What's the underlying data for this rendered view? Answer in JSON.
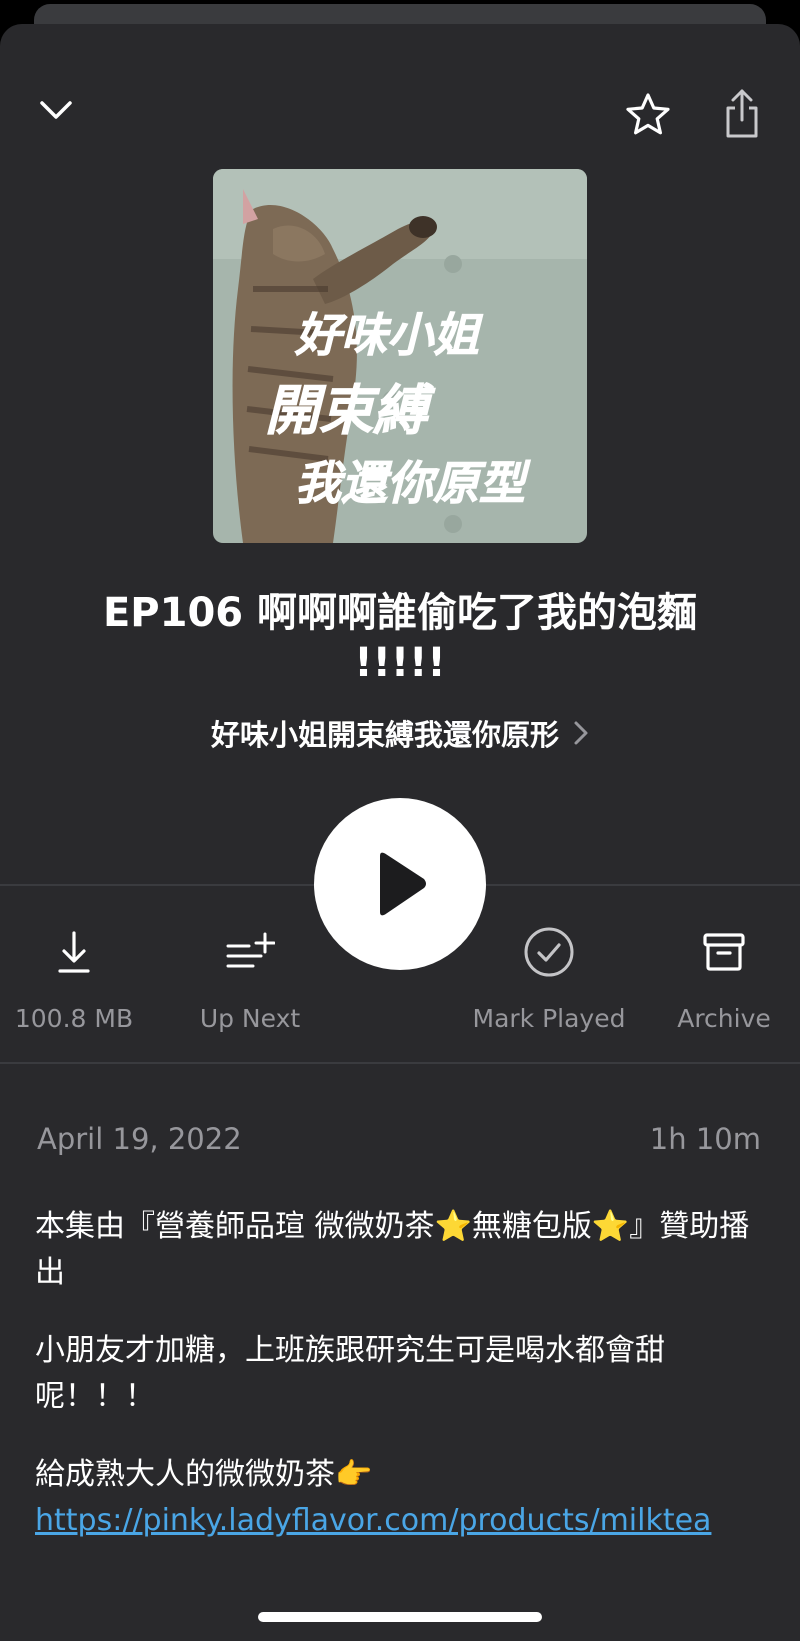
{
  "episode": {
    "title": "EP106 啊啊啊誰偷吃了我的泡麵 !!!!!",
    "podcast_name": "好味小姐開束縛我還你原形",
    "date": "April 19, 2022",
    "duration": "1h 10m"
  },
  "artwork": {
    "lines": [
      "好味小姐",
      "開束縛",
      "我還你原型"
    ]
  },
  "actions": {
    "download_label": "100.8 MB",
    "up_next_label": "Up Next",
    "mark_played_label": "Mark Played",
    "archive_label": "Archive"
  },
  "description": {
    "p1": "本集由『營養師品瑄 微微奶茶⭐️無糖包版⭐️』贊助播出",
    "p2": "小朋友才加糖，上班族跟研究生可是喝水都會甜呢！！！",
    "p3": "給成熟大人的微微奶茶👉",
    "link": "https://pinky.ladyflavor.com/products/milktea"
  },
  "colors": {
    "background": "#29292c",
    "secondary_text": "#97979c",
    "link": "#4aa6e6"
  },
  "icons": [
    "chevron-down-icon",
    "star-icon",
    "share-icon",
    "play-icon",
    "download-icon",
    "up-next-icon",
    "check-circle-icon",
    "archive-icon",
    "chevron-right-icon"
  ]
}
